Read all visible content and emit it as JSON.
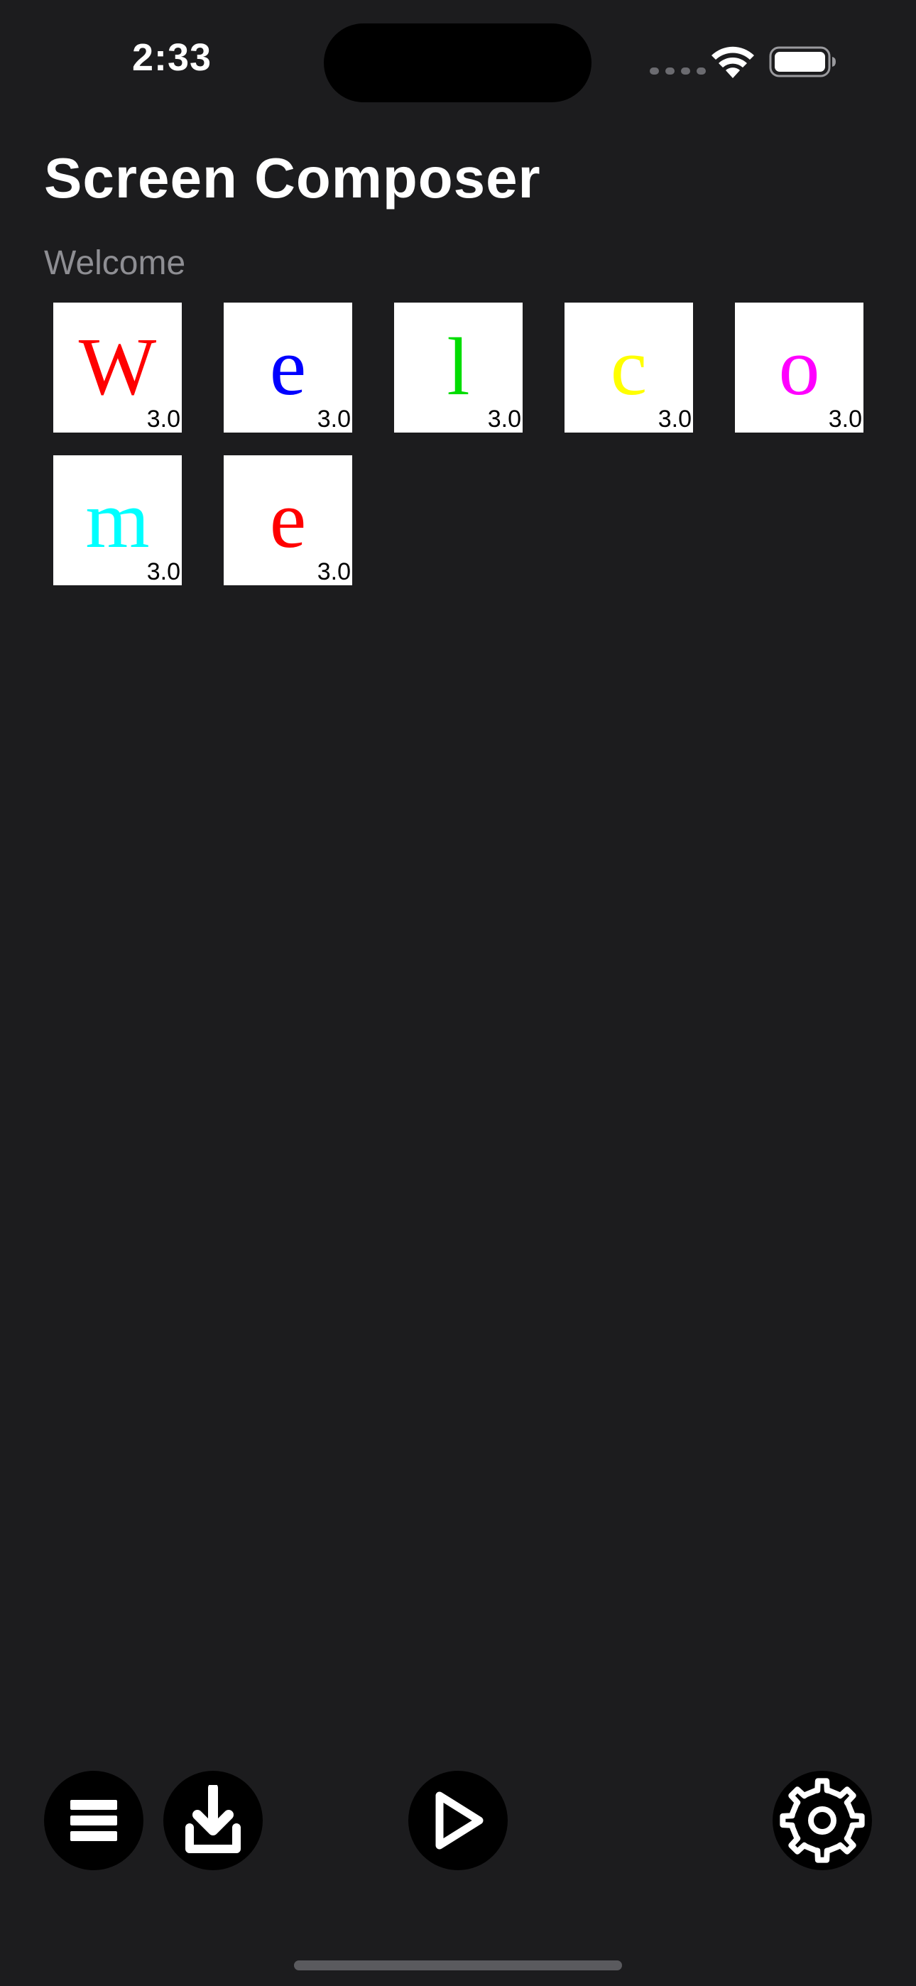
{
  "status_bar": {
    "time": "2:33"
  },
  "header": {
    "title": "Screen Composer",
    "subtitle": "Welcome"
  },
  "tiles": [
    {
      "letter": "W",
      "color": "#ff0000",
      "duration": "3.0"
    },
    {
      "letter": "e",
      "color": "#0000ff",
      "duration": "3.0"
    },
    {
      "letter": "l",
      "color": "#00dd00",
      "duration": "3.0"
    },
    {
      "letter": "c",
      "color": "#ffff00",
      "duration": "3.0"
    },
    {
      "letter": "o",
      "color": "#ff00ff",
      "duration": "3.0"
    },
    {
      "letter": "m",
      "color": "#00ffff",
      "duration": "3.0"
    },
    {
      "letter": "e",
      "color": "#ff0000",
      "duration": "3.0"
    }
  ],
  "toolbar": {
    "buttons": [
      {
        "id": "menu",
        "icon": "list-icon"
      },
      {
        "id": "download",
        "icon": "download-icon"
      },
      {
        "id": "play",
        "icon": "play-icon"
      },
      {
        "id": "settings",
        "icon": "gear-icon"
      }
    ]
  },
  "colors": {
    "background": "#1c1c1e",
    "subtitle": "#8e8e93",
    "button_background": "#000000",
    "tile_background": "#ffffff"
  }
}
